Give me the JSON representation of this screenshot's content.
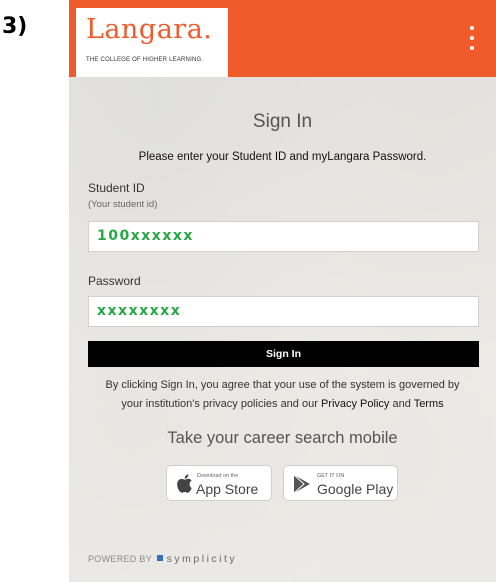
{
  "step_label": "3)",
  "header": {
    "logo_name": "Langara.",
    "logo_tagline": "THE COLLEGE OF HIGHER LEARNING."
  },
  "form": {
    "title": "Sign In",
    "instructions": "Please enter your Student ID and myLangara Password.",
    "student_id_label": "Student ID",
    "student_id_hint": "(Your student id)",
    "student_id_value": "100xxxxxx",
    "password_label": "Password",
    "password_value": "xxxxxxxx",
    "submit_label": "Sign In"
  },
  "agreement": {
    "line1": "By clicking Sign In, you agree that your use of the system is governed by",
    "line2_prefix": "your institution's privacy policies and our",
    "privacy_link": "Privacy Policy",
    "and": "and",
    "terms_link": "Terms"
  },
  "mobile": {
    "title": "Take your career search mobile",
    "app_store_small": "Download on the",
    "app_store_big": "App Store",
    "google_play_small": "GET IT ON",
    "google_play_big": "Google Play"
  },
  "footer": {
    "powered_by": "POWERED BY",
    "brand": "symplicity"
  },
  "colors": {
    "brand_orange": "#ef5b2b",
    "input_text_green": "#27a844",
    "button_black": "#000000"
  }
}
